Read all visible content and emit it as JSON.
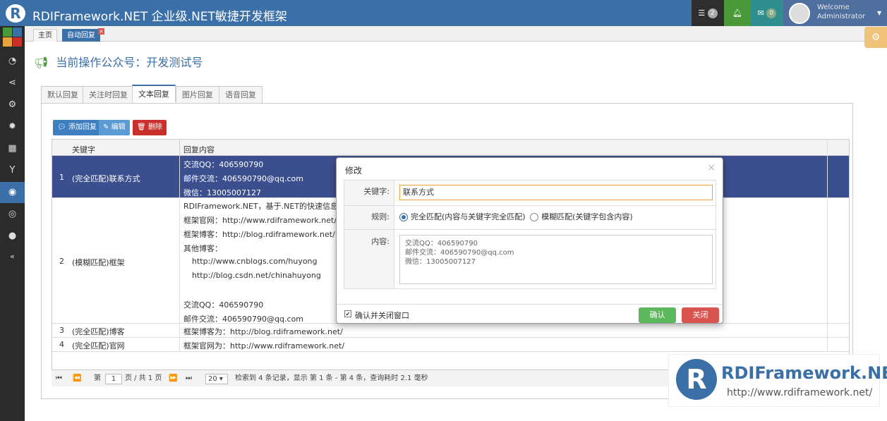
{
  "app": {
    "title": "RDIFramework.NET 企业级.NET敏捷开发框架",
    "logo_letter": "R"
  },
  "topbar": {
    "tasks_count": "2",
    "messages_count": "0",
    "welcome": "Welcome",
    "user": "Administrator"
  },
  "page_tabs": [
    {
      "label": "主页"
    },
    {
      "label": "自动回复"
    }
  ],
  "heading": "当前操作公众号：开发测试号",
  "reply_tabs": [
    "默认回复",
    "关注时回复",
    "文本回复",
    "图片回复",
    "语音回复"
  ],
  "toolbar": {
    "add": "添加回复",
    "edit": "编辑",
    "delete": "删除"
  },
  "grid": {
    "columns": [
      "关键字",
      "回复内容"
    ],
    "rows": [
      {
        "num": "1",
        "keyword": "(完全匹配)联系方式",
        "content": [
          "交流QQ：406590790",
          "邮件交流：406590790@qq.com",
          "微信：13005007127"
        ]
      },
      {
        "num": "2",
        "keyword": "(模糊匹配)框架",
        "content": [
          "RDIFramework.NET，基于.NET的快速信息化系",
          "框架官网：http://www.rdiframework.net/",
          "框架博客：http://blog.rdiframework.net/",
          "其他博客：",
          "    http://www.cnblogs.com/huyong",
          "    http://blog.csdn.net/chinahuyong",
          "",
          "交流QQ：406590790",
          "邮件交流：406590790@qq.com"
        ]
      },
      {
        "num": "3",
        "keyword": "(完全匹配)博客",
        "content": [
          "框架博客为：http://blog.rdiframework.net/"
        ]
      },
      {
        "num": "4",
        "keyword": "(完全匹配)官网",
        "content": [
          "框架官网为：http://www.rdiframework.net/"
        ]
      }
    ]
  },
  "pager": {
    "page_label": "第",
    "page": "1",
    "page_total": "页 / 共 1 页",
    "page_size": "20",
    "summary": "检索到 4 条记录，显示 第 1 条 - 第 4 条，查询耗时 2.1 毫秒"
  },
  "dialog": {
    "title": "修改",
    "keyword_label": "关键字:",
    "keyword_value": "联系方式",
    "rule_label": "规则:",
    "rule_exact": "完全匹配(内容与关键字完全匹配)",
    "rule_fuzzy": "模糊匹配(关键字包含内容)",
    "content_label": "内容:",
    "content_lines": [
      "交流QQ：406590790",
      "邮件交流：406590790@qq.com",
      "微信：13005007127"
    ],
    "confirm_close_label": "确认并关闭窗口",
    "ok": "确认",
    "close": "关闭"
  },
  "watermark": {
    "letter": "R",
    "title": "RDIFramework.NET",
    "url": "http://www.rdiframework.net/"
  },
  "colors": {
    "primary": "#3a6fa8",
    "selected_row": "#3b4f8f",
    "add_btn": "#3f7fbf",
    "edit_btn": "#5b9bd5",
    "delete_btn": "#c9302c",
    "ok_btn": "#5cb85c",
    "close_btn": "#d9534f"
  }
}
